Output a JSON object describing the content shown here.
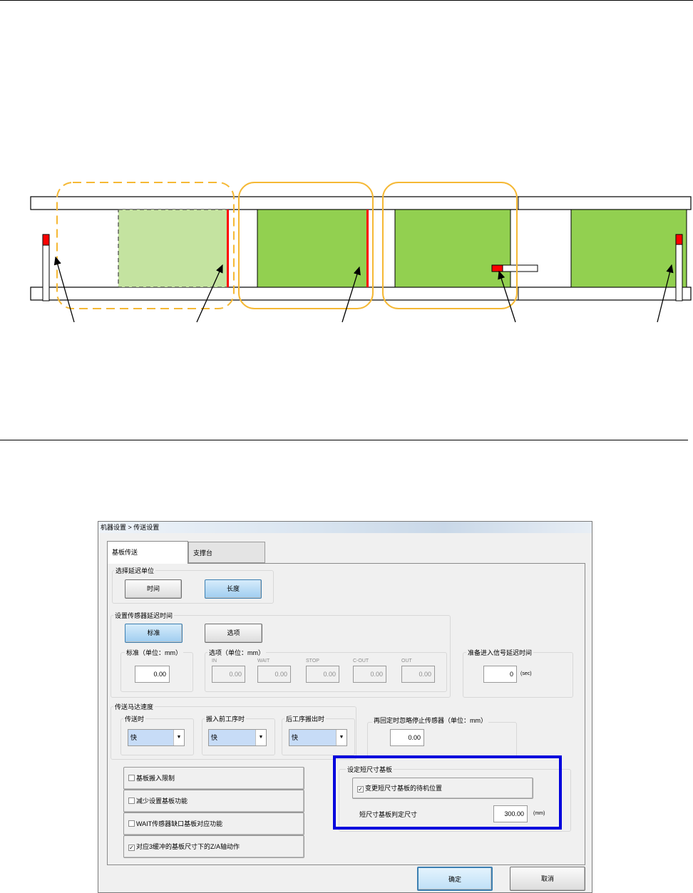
{
  "dialog": {
    "title": "机器设置 > 传送设置",
    "tabs": {
      "board": "基板传送",
      "support": "支撑台"
    },
    "delay_unit": {
      "group_label": "选择延迟单位",
      "time_button": "时间",
      "length_button": "长度"
    },
    "sensor_delay": {
      "group_label": "设置传感器延迟时间",
      "standard_button": "标准",
      "option_button": "选项",
      "standard_group": "标准（单位：mm）",
      "standard_value": "0.00",
      "option_group": "选项（单位：mm）",
      "options": [
        {
          "label": "IN",
          "value": "0.00"
        },
        {
          "label": "WAIT",
          "value": "0.00"
        },
        {
          "label": "STOP",
          "value": "0.00"
        },
        {
          "label": "C-OUT",
          "value": "0.00"
        },
        {
          "label": "OUT",
          "value": "0.00"
        }
      ]
    },
    "ready_signal": {
      "group_label": "准备进入信号延迟时间",
      "value": "0",
      "unit": "(sec)"
    },
    "motor_speed": {
      "group_label": "传送马达速度",
      "items": [
        {
          "label": "传送时",
          "value": "快"
        },
        {
          "label": "搬入前工序时",
          "value": "快"
        },
        {
          "label": "后工序搬出时",
          "value": "快"
        }
      ]
    },
    "reconfirm": {
      "label": "再回定时忽略停止传感器（单位：mm）",
      "value": "0.00"
    },
    "checkboxes": [
      {
        "label": "基板搬入限制",
        "checked": false
      },
      {
        "label": "减少设置基板功能",
        "checked": false
      },
      {
        "label": "WAIT传感器缺口基板对应功能",
        "checked": false
      },
      {
        "label": "对应3缓冲的基板尺寸下的Z/A轴动作",
        "checked": true
      }
    ],
    "short_board": {
      "group_label": "设定短尺寸基板",
      "checkbox_label": "变更短尺寸基板的待机位置",
      "checked": true,
      "size_label": "短尺寸基板判定尺寸",
      "size_value": "300.00",
      "size_unit": "(mm)"
    },
    "ok_button": "确定",
    "cancel_button": "取消"
  },
  "colors": {
    "board_green": "#92d050",
    "board_green_light": "#c4e3a0",
    "sensor_red": "#ff0000",
    "highlight_orange": "#f5b834",
    "highlight_blue": "#0000dd",
    "active_button": "#9fcdf0"
  }
}
